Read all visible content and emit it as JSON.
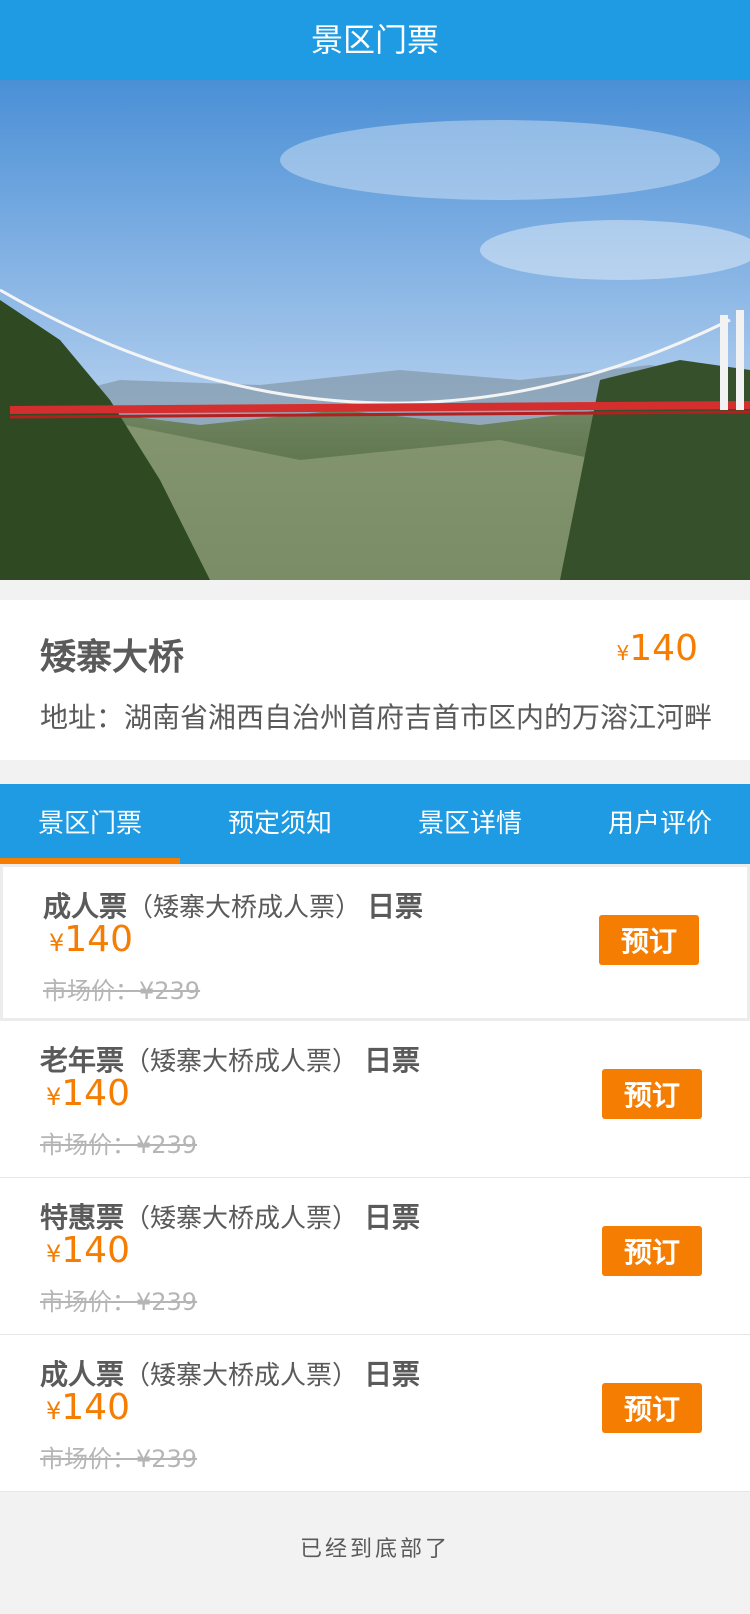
{
  "header": {
    "title": "景区门票"
  },
  "colors": {
    "brand_blue": "#1e9be2",
    "accent_orange": "#f57d02",
    "text_gray": "#5a5a5a",
    "muted_gray": "#b5b5b5"
  },
  "spot": {
    "name": "矮寨大桥",
    "address": "地址：湖南省湘西自治州首府吉首市区内的万溶江河畔",
    "currency": "¥",
    "price": "140"
  },
  "tabs": [
    {
      "label": "景区门票",
      "active": true
    },
    {
      "label": "预定须知"
    },
    {
      "label": "景区详情"
    },
    {
      "label": "用户评价"
    }
  ],
  "tickets": [
    {
      "type": "成人票",
      "subtitle": "（矮寨大桥成人票）",
      "day": "日票",
      "currency": "¥",
      "price": "140",
      "market": "市场价：¥239",
      "button": "预订"
    },
    {
      "type": "老年票",
      "subtitle": "（矮寨大桥成人票）",
      "day": "日票",
      "currency": "¥",
      "price": "140",
      "market": "市场价：¥239",
      "button": "预订"
    },
    {
      "type": "特惠票",
      "subtitle": "（矮寨大桥成人票）",
      "day": "日票",
      "currency": "¥",
      "price": "140",
      "market": "市场价：¥239",
      "button": "预订"
    },
    {
      "type": "成人票",
      "subtitle": "（矮寨大桥成人票）",
      "day": "日票",
      "currency": "¥",
      "price": "140",
      "market": "市场价：¥239",
      "button": "预订"
    }
  ],
  "footer": {
    "end_text": "已经到底部了"
  }
}
